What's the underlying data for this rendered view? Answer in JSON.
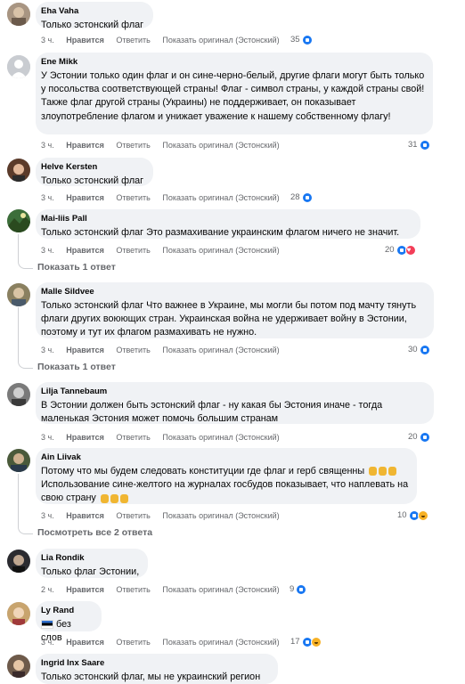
{
  "labels": {
    "like": "Нравится",
    "reply": "Ответить",
    "show_original": "Показать оригинал (Эстонский)",
    "show_one_reply": "Показать 1 ответ",
    "view_all_two_replies": "Посмотреть все 2 ответа"
  },
  "comments": [
    {
      "name": "Eha Vaha",
      "text": "Только эстонский флаг",
      "time": "3 ч.",
      "reactions": "35"
    },
    {
      "name": "Ene Mikk",
      "text": "У Эстонии только один флаг и он сине-черно-белый, другие флаги могут быть только у посольства соответствующей страны! Флаг - символ страны, у каждой страны свой! Также флаг другой страны (Украины) не поддерживает, он показывает злоупотребление флагом и унижает уважение к нашему собственному флагу!",
      "time": "3 ч.",
      "reactions": "31"
    },
    {
      "name": "Helve Kersten",
      "text": "Только эстонский флаг",
      "time": "3 ч.",
      "reactions": "28"
    },
    {
      "name": "Mai-liis Pall",
      "text": "Только эстонский флаг Это размахивание украинским флагом ничего не значит.",
      "time": "3 ч.",
      "reactions": "20"
    },
    {
      "name": "Malle Sildvee",
      "text": "Только эстонский флаг Что важнее в Украине, мы могли бы потом под мачту тянуть флаги других воюющих стран. Украинская война не удерживает войну в Эстонии, поэтому и тут их флагом размахивать не нужно.",
      "time": "3 ч.",
      "reactions": "30"
    },
    {
      "name": "Lilja Tannebaum",
      "text": "В Эстонии должен быть эстонский флаг - ну какая бы Эстония иначе - тогда маленькая Эстония может помочь большим странам",
      "time": "3 ч.",
      "reactions": "20"
    },
    {
      "name": "Ain Liivak",
      "text": "Потому что мы будем следовать конституции где флаг и герб священны",
      "text2": "Использование сине-желтого на журналах госбудов показывает, что наплевать на свою страну",
      "time": "3 ч.",
      "reactions": "10"
    },
    {
      "name": "Lia Rondik",
      "text": "Только флаг Эстонии,",
      "time": "2 ч.",
      "reactions": "9"
    },
    {
      "name": "Ly Rand",
      "text": "без слов",
      "time": "3 ч.",
      "reactions": "17"
    },
    {
      "name": "Ingrid Inx Saare",
      "text": "Только эстонский флаг, мы не украинский регион"
    }
  ],
  "colors": {
    "like": "#1877f2",
    "heart": "#f33e58",
    "haha": "#f7b125",
    "bubble": "#f0f2f5",
    "meta": "#65676b"
  }
}
